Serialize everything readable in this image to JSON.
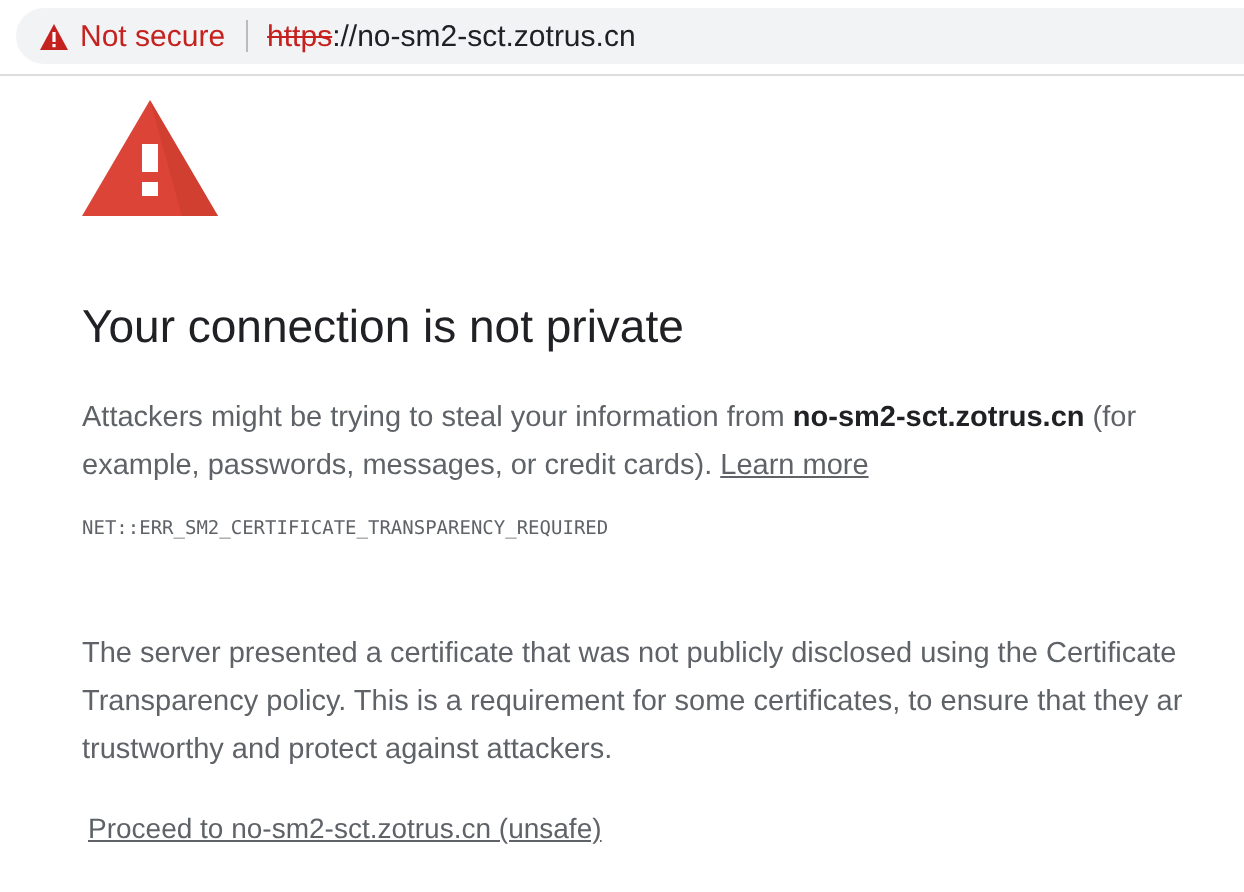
{
  "address_bar": {
    "security_label": "Not secure",
    "scheme": "https",
    "url_rest": "://no-sm2-sct.zotrus.cn"
  },
  "heading": "Your connection is not private",
  "message": "Attackers might be trying to steal your information from **no-sm2-sct.zotrus.cn** (for example, passwords, messages, or credit cards).",
  "learn_more": "Learn more",
  "error_code": "NET::ERR_SM2_CERTIFICATE_TRANSPARENCY_REQUIRED",
  "details_lines": [
    "The server presented a certificate that was not publicly disclosed using the Certificate",
    "Transparency policy. This is a requirement for some certificates, to ensure that they ar",
    "trustworthy and protect against attackers."
  ],
  "proceed_link": "Proceed to no-sm2-sct.zotrus.cn (unsafe)"
}
